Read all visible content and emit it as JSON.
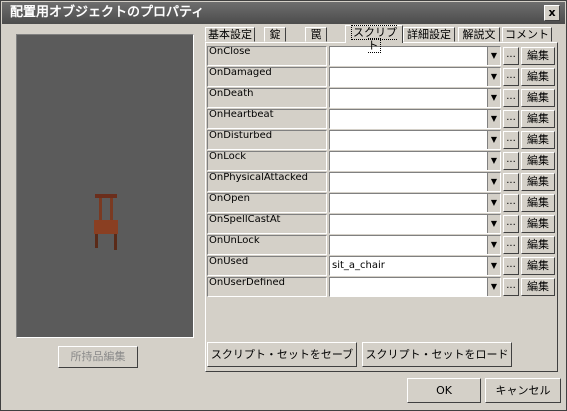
{
  "window": {
    "title": "配置用オブジェクトのプロパティ",
    "close_glyph": "x"
  },
  "left": {
    "inventory_button": "所持品編集"
  },
  "tabs": [
    {
      "label": "基本設定",
      "active": false
    },
    {
      "label": "錠",
      "active": false
    },
    {
      "label": "罠",
      "active": false
    },
    {
      "label": "スクリプト",
      "active": true
    },
    {
      "label": "詳細設定",
      "active": false
    },
    {
      "label": "解説文",
      "active": false
    },
    {
      "label": "コメント",
      "active": false
    }
  ],
  "scripts": [
    {
      "event": "OnClose",
      "value": ""
    },
    {
      "event": "OnDamaged",
      "value": ""
    },
    {
      "event": "OnDeath",
      "value": ""
    },
    {
      "event": "OnHeartbeat",
      "value": ""
    },
    {
      "event": "OnDisturbed",
      "value": ""
    },
    {
      "event": "OnLock",
      "value": ""
    },
    {
      "event": "OnPhysicalAttacked",
      "value": ""
    },
    {
      "event": "OnOpen",
      "value": ""
    },
    {
      "event": "OnSpellCastAt",
      "value": ""
    },
    {
      "event": "OnUnLock",
      "value": ""
    },
    {
      "event": "OnUsed",
      "value": "sit_a_chair"
    },
    {
      "event": "OnUserDefined",
      "value": ""
    }
  ],
  "row_buttons": {
    "browse": "...",
    "edit": "編集",
    "dropdown_glyph": "▼"
  },
  "script_set": {
    "save": "スクリプト・セットをセーブ",
    "load": "スクリプト・セットをロード"
  },
  "footer": {
    "ok": "OK",
    "cancel": "キャンセル"
  }
}
